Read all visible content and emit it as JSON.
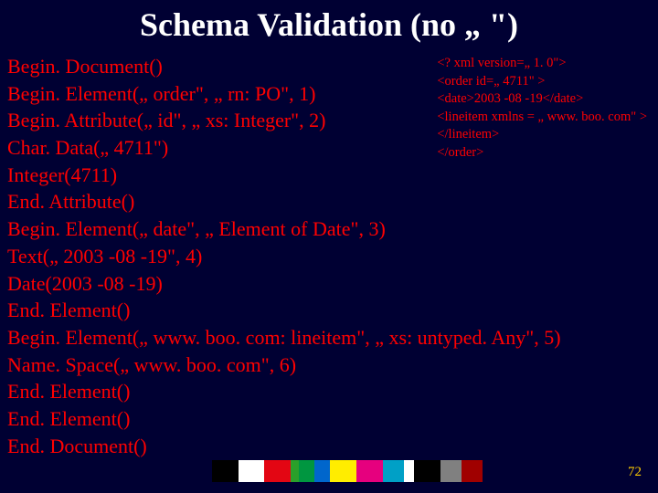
{
  "title": "Schema Validation (no „ \")",
  "calls": [
    "Begin. Document()",
    "Begin. Element(„ order\", „ rn: PO\", 1)",
    "Begin. Attribute(„ id\", „ xs: Integer\", 2)",
    "Char. Data(„ 4711\")",
    "Integer(4711)",
    "End. Attribute()",
    "Begin. Element(„ date\", „ Element of Date\", 3)",
    "Text(„ 2003 -08 -19\", 4)",
    "Date(2003 -08 -19)",
    "End. Element()",
    "Begin. Element(„ www. boo. com: lineitem\", „ xs: untyped. Any\", 5)",
    "Name. Space(„ www. boo. com\", 6)",
    "End. Element()",
    "End. Element()",
    "End. Document()"
  ],
  "xml": [
    "<? xml version=„ 1. 0\">",
    "<order id=„ 4711\" >",
    "<date>2003 -08 -19</date>",
    "<lineitem xmlns = „ www. boo. com\" >",
    "</lineitem>",
    "</order>"
  ],
  "colorbar": [
    {
      "color": "#000000",
      "w": 10
    },
    {
      "color": "#ffffff",
      "w": 10
    },
    {
      "color": "#e30613",
      "w": 10
    },
    {
      "color": "#2aa02a",
      "w": 3
    },
    {
      "color": "#009640",
      "w": 6
    },
    {
      "color": "#0066cc",
      "w": 6
    },
    {
      "color": "#ffed00",
      "w": 10
    },
    {
      "color": "#e6007e",
      "w": 10
    },
    {
      "color": "#00a0c6",
      "w": 8
    },
    {
      "color": "#ffffff",
      "w": 4
    },
    {
      "color": "#000000",
      "w": 10
    },
    {
      "color": "#808080",
      "w": 8
    },
    {
      "color": "#a00000",
      "w": 8
    }
  ],
  "pagenum": "72"
}
